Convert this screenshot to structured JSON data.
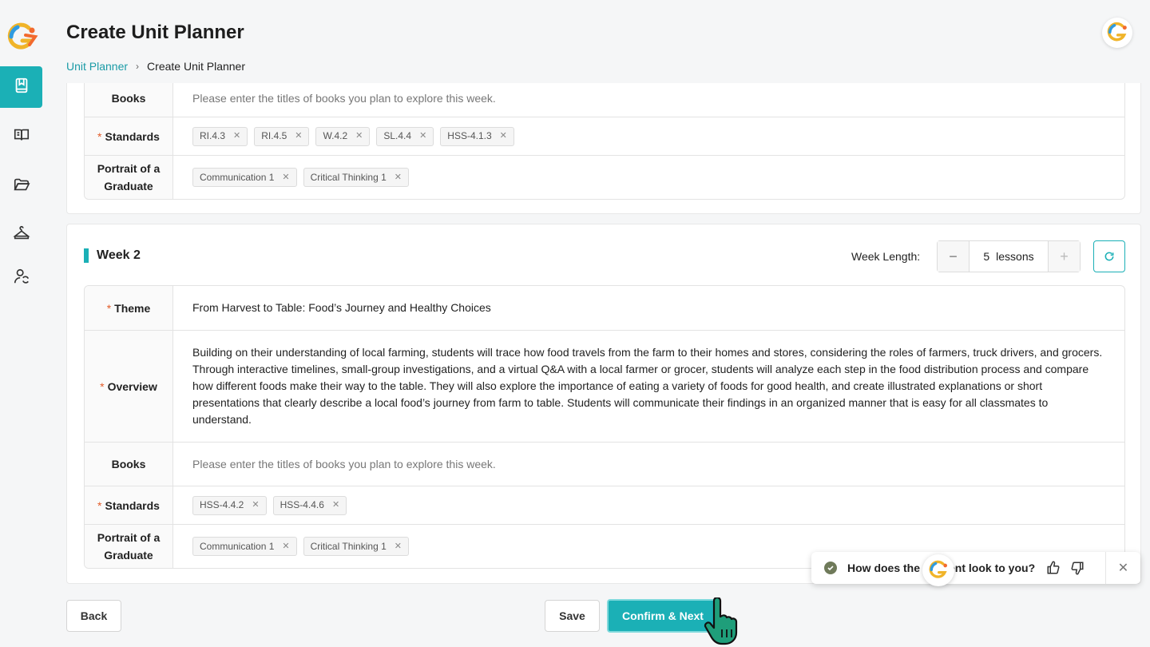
{
  "header": {
    "title": "Create Unit Planner",
    "breadcrumb": {
      "link": "Unit Planner",
      "separator": "›",
      "current": "Create Unit Planner"
    }
  },
  "sidebar": {
    "items": [
      {
        "icon": "book-icon",
        "active": true
      },
      {
        "icon": "reader-icon",
        "active": false
      },
      {
        "icon": "folder-icon",
        "active": false
      },
      {
        "icon": "hanger-icon",
        "active": false
      },
      {
        "icon": "user-refresh-icon",
        "active": false
      }
    ]
  },
  "week1": {
    "books": {
      "label": "Books",
      "placeholder": "Please enter the titles of books you plan to explore this week."
    },
    "standards": {
      "required_mark": "*",
      "label": "Standards",
      "tags": [
        "RI.4.3",
        "RI.4.5",
        "W.4.2",
        "SL.4.4",
        "HSS-4.1.3"
      ]
    },
    "portrait": {
      "label_line1": "Portrait of a",
      "label_line2": "Graduate",
      "tags": [
        "Communication 1",
        "Critical Thinking 1"
      ]
    }
  },
  "week2": {
    "title": "Week 2",
    "week_length_label": "Week Length:",
    "lessons_count": "5",
    "lessons_unit": "lessons",
    "minus": "−",
    "plus": "+",
    "theme": {
      "required_mark": "*",
      "label": "Theme",
      "value": "From Harvest to Table: Food’s Journey and Healthy Choices"
    },
    "overview": {
      "required_mark": "*",
      "label": "Overview",
      "value": "Building on their understanding of local farming, students will trace how food travels from the farm to their homes and stores, considering the roles of farmers, truck drivers, and grocers. Through interactive timelines, small-group investigations, and a virtual Q&A with a local farmer or grocer, students will analyze each step in the food distribution process and compare how different foods make their way to the table. They will also explore the importance of eating a variety of foods for good health, and create illustrated explanations or short presentations that clearly describe a local food’s journey from farm to table. Students will communicate their findings in an organized manner that is easy for all classmates to understand."
    },
    "books": {
      "label": "Books",
      "placeholder": "Please enter the titles of books you plan to explore this week."
    },
    "standards": {
      "required_mark": "*",
      "label": "Standards",
      "tags": [
        "HSS-4.4.2",
        "HSS-4.4.6"
      ]
    },
    "portrait": {
      "label_line1": "Portrait of a",
      "label_line2": "Graduate",
      "tags": [
        "Communication 1",
        "Critical Thinking 1"
      ]
    }
  },
  "footer": {
    "back": "Back",
    "save": "Save",
    "confirm": "Confirm & Next"
  },
  "feedback": {
    "question_prefix": "How does the",
    "question_suffix": "ent look to you?",
    "close": "✕"
  },
  "colors": {
    "accent": "#1bb0b6",
    "required": "#e25c2a",
    "link": "#1a9ba6"
  }
}
